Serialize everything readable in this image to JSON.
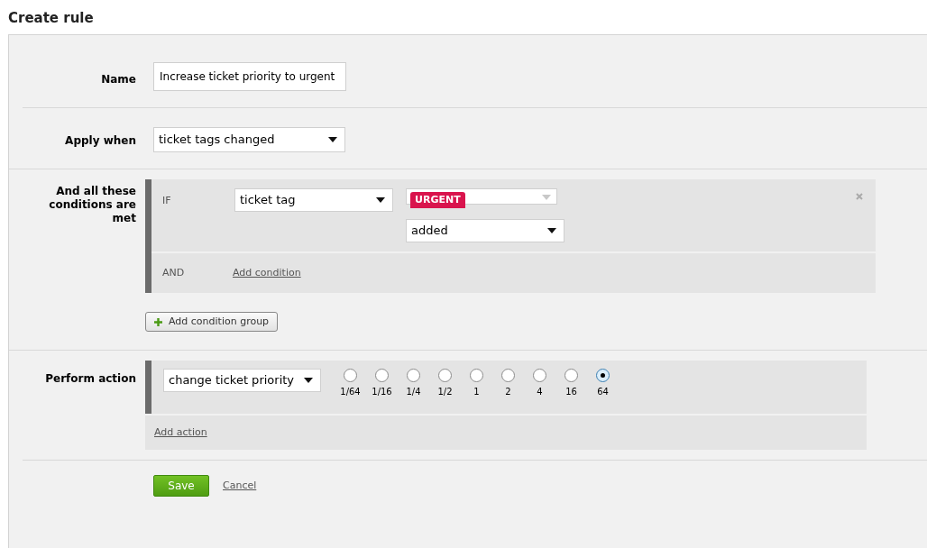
{
  "title": "Create rule",
  "name_field": {
    "label": "Name",
    "value": "Increase ticket priority to urgent"
  },
  "apply_when": {
    "label": "Apply when",
    "value": "ticket tags changed"
  },
  "conditions": {
    "label": "And all these conditions are met",
    "if_label": "IF",
    "field": "ticket tag",
    "tag": "URGENT",
    "operator": "added",
    "and_label": "AND",
    "add_condition": "Add condition",
    "add_group": "Add condition group"
  },
  "action": {
    "label": "Perform action",
    "value": "change ticket priority",
    "options": [
      {
        "label": "1/64",
        "selected": false
      },
      {
        "label": "1/16",
        "selected": false
      },
      {
        "label": "1/4",
        "selected": false
      },
      {
        "label": "1/2",
        "selected": false
      },
      {
        "label": "1",
        "selected": false
      },
      {
        "label": "2",
        "selected": false
      },
      {
        "label": "4",
        "selected": false
      },
      {
        "label": "16",
        "selected": false
      },
      {
        "label": "64",
        "selected": true
      }
    ],
    "add_action": "Add action"
  },
  "buttons": {
    "save": "Save",
    "cancel": "Cancel"
  }
}
